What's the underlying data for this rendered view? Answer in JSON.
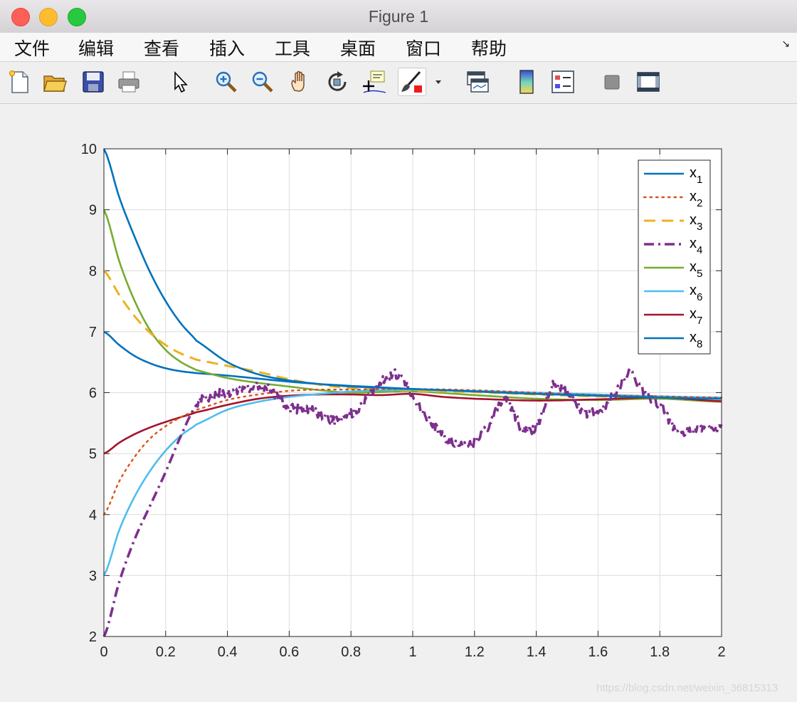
{
  "window": {
    "title": "Figure 1"
  },
  "menu": [
    "文件",
    "编辑",
    "查看",
    "插入",
    "工具",
    "桌面",
    "窗口",
    "帮助"
  ],
  "toolbar": [
    "new-figure",
    "open-file",
    "save",
    "print",
    "pointer",
    "zoom-in",
    "zoom-out",
    "pan",
    "rotate-3d",
    "data-cursor",
    "brush",
    "brush-dropdown",
    "link-plot",
    "colorbar",
    "legend",
    "hide-plot-tools",
    "show-plot-tools"
  ],
  "watermark": "https://blog.csdn.net/weixin_36815313",
  "chart_data": {
    "type": "line",
    "title": "",
    "xlabel": "",
    "ylabel": "",
    "xlim": [
      0,
      2
    ],
    "ylim": [
      2,
      10
    ],
    "xticks": [
      "0",
      "0.2",
      "0.4",
      "0.6",
      "0.8",
      "1",
      "1.2",
      "1.4",
      "1.6",
      "1.8",
      "2"
    ],
    "yticks": [
      "2",
      "3",
      "4",
      "5",
      "6",
      "7",
      "8",
      "9",
      "10"
    ],
    "grid": true,
    "legend_position": "top-right",
    "series": [
      {
        "name": "x1",
        "base": "x",
        "sub": "1",
        "color": "#0072bd",
        "style": "solid",
        "x": [
          0,
          0.05,
          0.1,
          0.15,
          0.2,
          0.25,
          0.3,
          0.4,
          0.5,
          0.6,
          0.7,
          0.8,
          1.0,
          1.2,
          1.4,
          1.6,
          1.8,
          2.0
        ],
        "y": [
          10,
          9.2,
          8.55,
          7.97,
          7.5,
          7.13,
          6.85,
          6.5,
          6.3,
          6.2,
          6.14,
          6.1,
          6.06,
          6.02,
          5.98,
          5.95,
          5.92,
          5.9
        ]
      },
      {
        "name": "x2",
        "base": "x",
        "sub": "2",
        "color": "#d95319",
        "style": "dotted",
        "x": [
          0,
          0.05,
          0.1,
          0.15,
          0.2,
          0.25,
          0.3,
          0.4,
          0.5,
          0.6,
          0.7,
          0.8,
          1.0,
          1.2,
          1.4,
          1.6,
          1.8,
          2.0
        ],
        "y": [
          4,
          4.55,
          4.95,
          5.25,
          5.45,
          5.6,
          5.72,
          5.88,
          5.97,
          6.03,
          6.05,
          6.05,
          6.06,
          6.04,
          6.0,
          5.96,
          5.94,
          5.92
        ]
      },
      {
        "name": "x3",
        "base": "x",
        "sub": "3",
        "color": "#edb120",
        "style": "dashed",
        "x": [
          0,
          0.05,
          0.1,
          0.15,
          0.2,
          0.25,
          0.3,
          0.4,
          0.5,
          0.6,
          0.7,
          0.8,
          1.0,
          1.2,
          1.4,
          1.6,
          1.8,
          2.0
        ],
        "y": [
          8,
          7.6,
          7.25,
          6.98,
          6.78,
          6.64,
          6.54,
          6.44,
          6.34,
          6.22,
          6.13,
          6.07,
          6.03,
          6.01,
          5.97,
          5.94,
          5.93,
          5.9
        ]
      },
      {
        "name": "x4",
        "base": "x",
        "sub": "4",
        "color": "#7e2f8e",
        "style": "dashdot",
        "noisy": true,
        "x": [
          0,
          0.05,
          0.1,
          0.15,
          0.2,
          0.25,
          0.3,
          0.35,
          0.4,
          0.45,
          0.5,
          0.55,
          0.6,
          0.65,
          0.7,
          0.75,
          0.8,
          0.85,
          0.9,
          0.95,
          1.0,
          1.05,
          1.1,
          1.15,
          1.2,
          1.25,
          1.3,
          1.35,
          1.4,
          1.45,
          1.5,
          1.55,
          1.6,
          1.65,
          1.7,
          1.75,
          1.8,
          1.85,
          1.9,
          1.95,
          2.0
        ],
        "y": [
          2,
          2.9,
          3.6,
          4.15,
          4.7,
          5.3,
          5.8,
          5.95,
          6.0,
          6.05,
          6.1,
          6.0,
          5.75,
          5.75,
          5.65,
          5.55,
          5.65,
          5.9,
          6.2,
          6.3,
          5.95,
          5.55,
          5.3,
          5.12,
          5.2,
          5.5,
          5.9,
          5.45,
          5.45,
          6.1,
          6.0,
          5.7,
          5.7,
          5.95,
          6.3,
          6.0,
          5.8,
          5.4,
          5.35,
          5.45,
          5.4
        ]
      },
      {
        "name": "x5",
        "base": "x",
        "sub": "5",
        "color": "#77ac30",
        "style": "solid",
        "x": [
          0,
          0.05,
          0.1,
          0.15,
          0.2,
          0.25,
          0.3,
          0.4,
          0.5,
          0.6,
          0.7,
          0.8,
          1.0,
          1.2,
          1.4,
          1.6,
          1.8,
          2.0
        ],
        "y": [
          9,
          8.15,
          7.5,
          7.02,
          6.7,
          6.5,
          6.37,
          6.24,
          6.16,
          6.1,
          6.04,
          6.0,
          6.02,
          5.96,
          5.9,
          5.88,
          5.9,
          5.85
        ]
      },
      {
        "name": "x6",
        "base": "x",
        "sub": "6",
        "color": "#4dbeee",
        "style": "solid",
        "x": [
          0,
          0.05,
          0.1,
          0.15,
          0.2,
          0.25,
          0.3,
          0.4,
          0.5,
          0.6,
          0.7,
          0.8,
          1.0,
          1.2,
          1.4,
          1.6,
          1.8,
          2.0
        ],
        "y": [
          3,
          3.75,
          4.3,
          4.72,
          5.05,
          5.3,
          5.48,
          5.72,
          5.85,
          5.93,
          5.98,
          6.02,
          6.05,
          6.03,
          6.0,
          5.97,
          5.94,
          5.92
        ]
      },
      {
        "name": "x7",
        "base": "x",
        "sub": "7",
        "color": "#a2142f",
        "style": "solid",
        "x": [
          0,
          0.05,
          0.1,
          0.15,
          0.2,
          0.25,
          0.3,
          0.4,
          0.5,
          0.6,
          0.7,
          0.8,
          0.9,
          1.0,
          1.1,
          1.2,
          1.4,
          1.6,
          1.8,
          2.0
        ],
        "y": [
          5,
          5.18,
          5.32,
          5.43,
          5.52,
          5.6,
          5.68,
          5.8,
          5.9,
          5.95,
          5.97,
          5.97,
          5.96,
          5.98,
          5.93,
          5.9,
          5.87,
          5.89,
          5.92,
          5.86
        ]
      },
      {
        "name": "x8",
        "base": "x",
        "sub": "8",
        "color": "#0072bd",
        "style": "solid",
        "x": [
          0,
          0.05,
          0.1,
          0.15,
          0.2,
          0.25,
          0.3,
          0.4,
          0.5,
          0.6,
          0.7,
          0.8,
          1.0,
          1.2,
          1.4,
          1.6,
          1.8,
          2.0
        ],
        "y": [
          7,
          6.78,
          6.6,
          6.48,
          6.4,
          6.35,
          6.32,
          6.28,
          6.23,
          6.18,
          6.14,
          6.11,
          6.06,
          6.02,
          5.98,
          5.95,
          5.93,
          5.9
        ]
      }
    ]
  }
}
